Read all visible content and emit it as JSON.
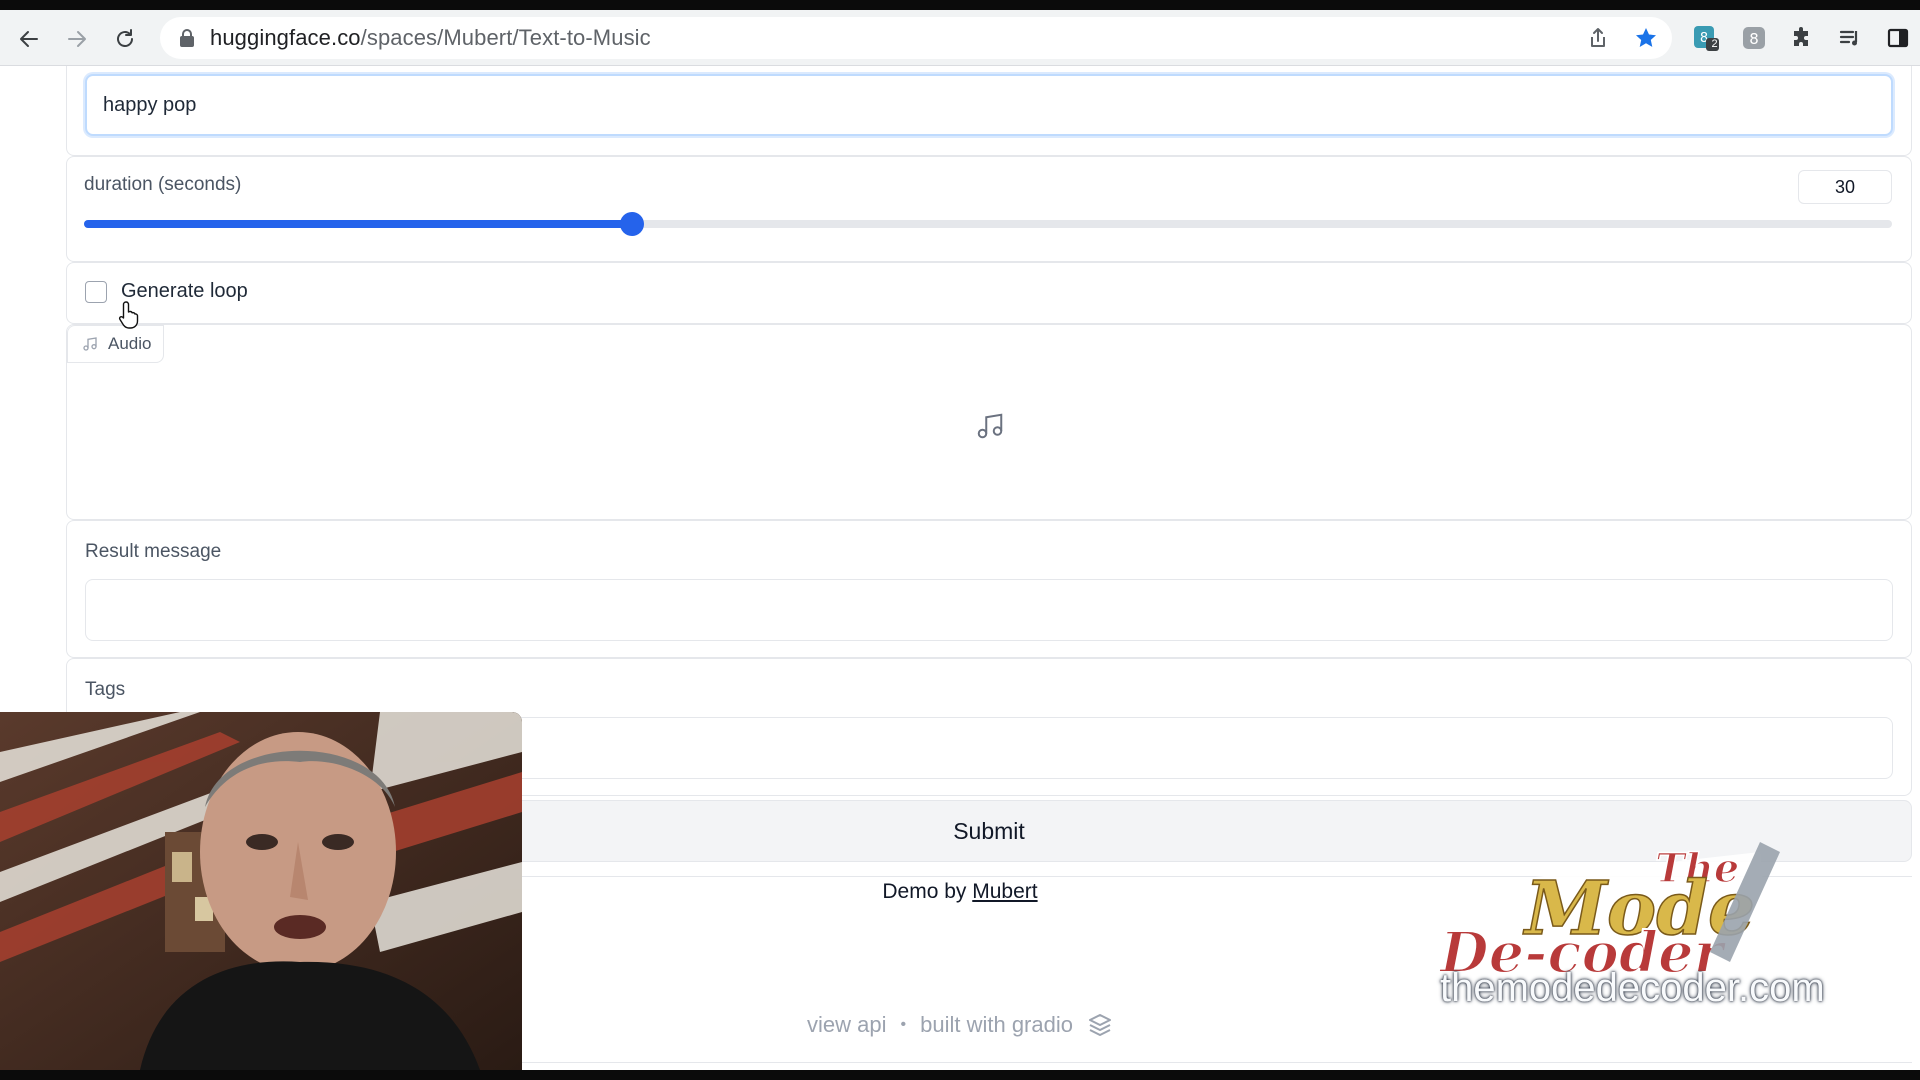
{
  "browser": {
    "url_host": "huggingface.co",
    "url_path": "/spaces/Mubert/Text-to-Music",
    "extension_badge": "2"
  },
  "form": {
    "prompt_value": "happy pop",
    "duration_label": "duration (seconds)",
    "duration_value": "30",
    "duration_fraction": 0.303,
    "loop_label": "Generate loop",
    "loop_checked": false,
    "audio_label": "Audio",
    "result_label": "Result message",
    "result_value": "",
    "tags_label": "Tags",
    "tags_value": "",
    "submit_label": "Submit"
  },
  "footer": {
    "demo_prefix": "Demo by",
    "demo_link": "Mubert",
    "view_api": "view api",
    "separator": "•",
    "built_with": "built with gradio"
  },
  "watermark": {
    "logo_line1": "The",
    "logo_line2": "Mode",
    "logo_line3": "De-coder",
    "site": "themodedecoder.com"
  },
  "colors": {
    "accent": "#2563eb",
    "logo_red": "#b83a3a",
    "logo_gold": "#d9b84a"
  }
}
